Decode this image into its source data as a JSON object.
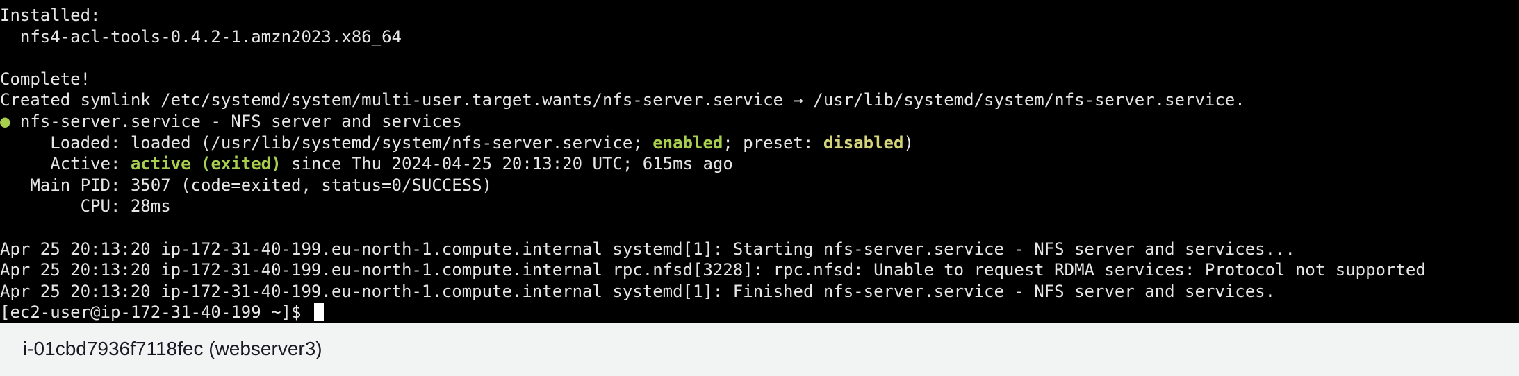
{
  "terminal": {
    "lines": [
      {
        "text": "Installed:"
      },
      {
        "text": "  nfs4-acl-tools-0.4.2-1.amzn2023.x86_64"
      },
      {
        "text": ""
      },
      {
        "text": "Complete!"
      },
      {
        "text": "Created symlink /etc/systemd/system/multi-user.target.wants/nfs-server.service → /usr/lib/systemd/system/nfs-server.service."
      },
      {
        "status_dot": "●",
        "text": " nfs-server.service - NFS server and services"
      },
      {
        "prefix": "     Loaded: loaded (/usr/lib/systemd/system/nfs-server.service; ",
        "enabled": "enabled",
        "middle": "; preset: ",
        "disabled": "disabled",
        "suffix": ")"
      },
      {
        "prefix": "     Active: ",
        "active": "active (exited)",
        "suffix": " since Thu 2024-04-25 20:13:20 UTC; 615ms ago"
      },
      {
        "text": "   Main PID: 3507 (code=exited, status=0/SUCCESS)"
      },
      {
        "text": "        CPU: 28ms"
      },
      {
        "text": ""
      },
      {
        "text": "Apr 25 20:13:20 ip-172-31-40-199.eu-north-1.compute.internal systemd[1]: Starting nfs-server.service - NFS server and services..."
      },
      {
        "text": "Apr 25 20:13:20 ip-172-31-40-199.eu-north-1.compute.internal rpc.nfsd[3228]: rpc.nfsd: Unable to request RDMA services: Protocol not supported"
      },
      {
        "text": "Apr 25 20:13:20 ip-172-31-40-199.eu-north-1.compute.internal systemd[1]: Finished nfs-server.service - NFS server and services."
      }
    ],
    "prompt": "[ec2-user@ip-172-31-40-199 ~]$ "
  },
  "footer": {
    "instance_label": "i-01cbd7936f7118fec (webserver3)"
  },
  "colors": {
    "terminal_bg": "#000000",
    "terminal_fg": "#e6e6e6",
    "status_green": "#a8d04e",
    "status_yellow": "#d4d47a",
    "footer_bg": "#f2f3f3"
  }
}
